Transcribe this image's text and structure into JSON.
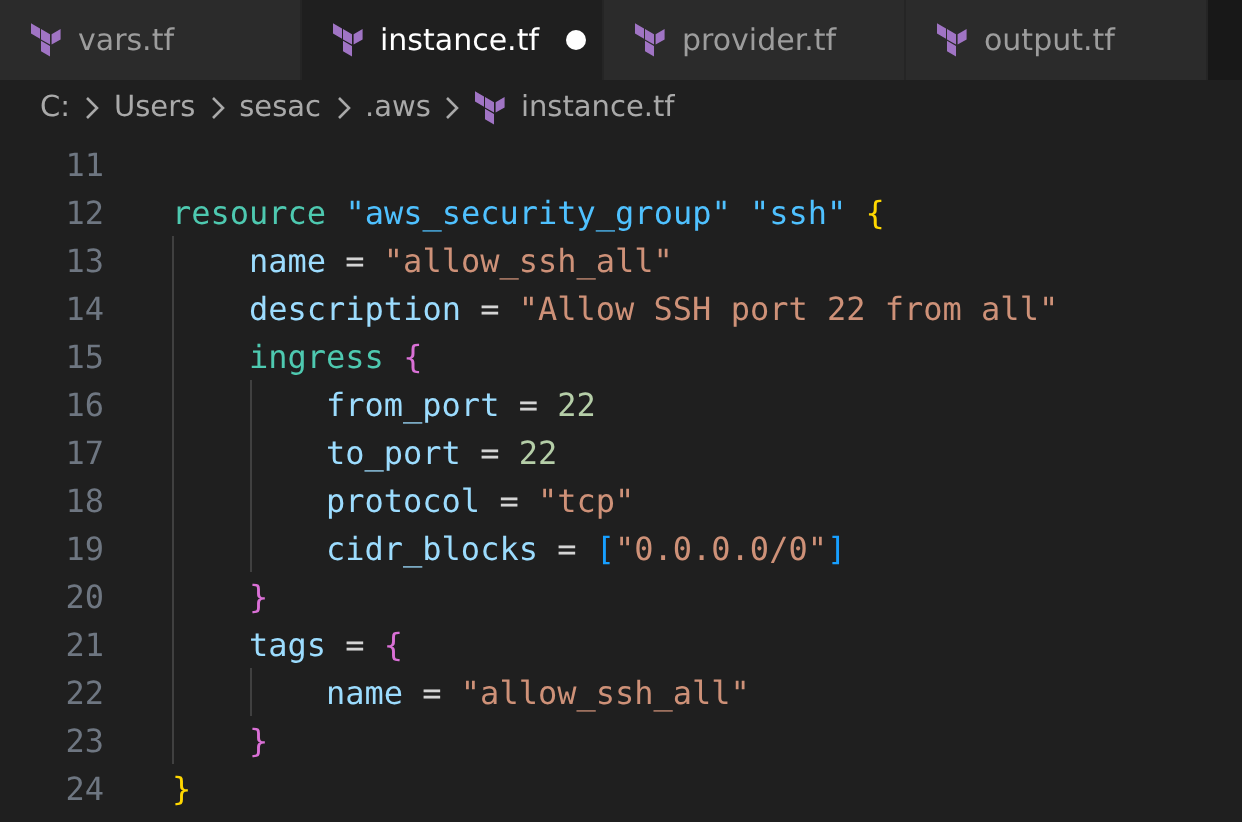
{
  "tabs": [
    {
      "label": "vars.tf",
      "selected": false,
      "modified": false
    },
    {
      "label": "instance.tf",
      "selected": true,
      "modified": true
    },
    {
      "label": "provider.tf",
      "selected": false,
      "modified": false
    },
    {
      "label": "output.tf",
      "selected": false,
      "modified": false
    }
  ],
  "breadcrumb": [
    {
      "label": "C:",
      "kind": "folder"
    },
    {
      "label": "Users",
      "kind": "folder"
    },
    {
      "label": "sesac",
      "kind": "folder"
    },
    {
      "label": ".aws",
      "kind": "folder"
    },
    {
      "label": "instance.tf",
      "kind": "file"
    }
  ],
  "code": [
    {
      "number": "11"
    },
    {
      "number": "12",
      "tokens": [
        {
          "text": "resource",
          "kind": "keyword"
        },
        {
          "text": "\"aws_security_group\"",
          "kind": "label"
        },
        {
          "text": "\"ssh\"",
          "kind": "label"
        },
        {
          "text": "{",
          "kind": "bracket1"
        }
      ],
      "children": [
        {
          "number": "13",
          "tokens": [
            {
              "text": "name",
              "kind": "property"
            },
            {
              "text": "=",
              "kind": "op"
            },
            {
              "text": "\"allow_ssh_all\"",
              "kind": "string"
            }
          ]
        },
        {
          "number": "14",
          "tokens": [
            {
              "text": "description",
              "kind": "property"
            },
            {
              "text": "=",
              "kind": "op"
            },
            {
              "text": "\"Allow SSH port 22 from all\"",
              "kind": "string"
            }
          ]
        },
        {
          "number": "15",
          "tokens": [
            {
              "text": "ingress",
              "kind": "keyword"
            },
            {
              "text": "{",
              "kind": "bracket2"
            }
          ],
          "children": [
            {
              "number": "16",
              "tokens": [
                {
                  "text": "from_port",
                  "kind": "property"
                },
                {
                  "text": "=",
                  "kind": "op"
                },
                {
                  "text": "22",
                  "kind": "number"
                }
              ]
            },
            {
              "number": "17",
              "tokens": [
                {
                  "text": "to_port",
                  "kind": "property"
                },
                {
                  "text": "=",
                  "kind": "op"
                },
                {
                  "text": "22",
                  "kind": "number"
                }
              ]
            },
            {
              "number": "18",
              "tokens": [
                {
                  "text": "protocol",
                  "kind": "property"
                },
                {
                  "text": "=",
                  "kind": "op"
                },
                {
                  "text": "\"tcp\"",
                  "kind": "string"
                }
              ]
            },
            {
              "number": "19",
              "tokens": [
                {
                  "text": "cidr_blocks",
                  "kind": "property"
                },
                {
                  "text": "=",
                  "kind": "op"
                },
                {
                  "text": "[",
                  "kind": "bracket3",
                  "join": true
                },
                {
                  "text": "\"0.0.0.0/0\"",
                  "kind": "string",
                  "join": true
                },
                {
                  "text": "]",
                  "kind": "bracket3"
                }
              ]
            }
          ]
        },
        {
          "number": "20",
          "tokens": [
            {
              "text": "}",
              "kind": "bracket2"
            }
          ]
        },
        {
          "number": "21",
          "tokens": [
            {
              "text": "tags",
              "kind": "property"
            },
            {
              "text": "=",
              "kind": "op"
            },
            {
              "text": "{",
              "kind": "bracket2"
            }
          ],
          "children": [
            {
              "number": "22",
              "tokens": [
                {
                  "text": "name",
                  "kind": "property"
                },
                {
                  "text": "=",
                  "kind": "op"
                },
                {
                  "text": "\"allow_ssh_all\"",
                  "kind": "string"
                }
              ]
            }
          ]
        },
        {
          "number": "23",
          "tokens": [
            {
              "text": "}",
              "kind": "bracket2"
            }
          ]
        }
      ]
    },
    {
      "number": "24",
      "tokens": [
        {
          "text": "}",
          "kind": "bracket1"
        }
      ]
    }
  ]
}
